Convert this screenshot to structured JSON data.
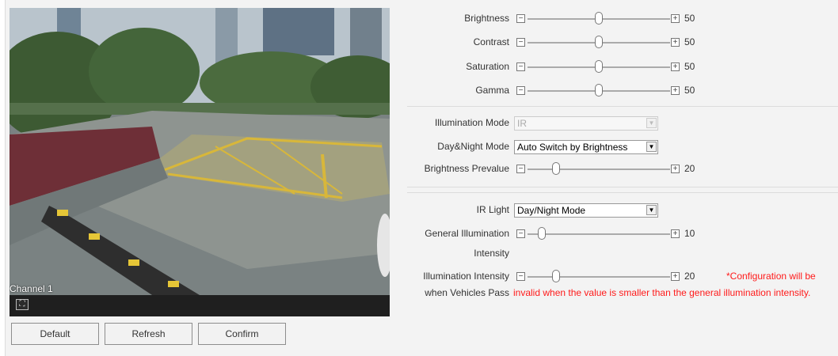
{
  "video": {
    "channel_label": "Channel 1",
    "fullscreen_icon": "fullscreen-icon"
  },
  "buttons": {
    "default": "Default",
    "refresh": "Refresh",
    "confirm": "Confirm"
  },
  "sliders": {
    "brightness": {
      "label": "Brightness",
      "value": "50",
      "level": 0.5
    },
    "contrast": {
      "label": "Contrast",
      "value": "50",
      "level": 0.5
    },
    "saturation": {
      "label": "Saturation",
      "value": "50",
      "level": 0.5
    },
    "gamma": {
      "label": "Gamma",
      "value": "50",
      "level": 0.5
    },
    "brightness_prevalue": {
      "label": "Brightness Prevalue",
      "value": "20",
      "level": 0.2
    },
    "general_illumination": {
      "label_line1": "General Illumination",
      "label_line2": "Intensity",
      "value": "10",
      "level": 0.1
    },
    "vehicle_illumination": {
      "label_line1": "Illumination Intensity",
      "label_line2": "when Vehicles Pass",
      "value": "20",
      "level": 0.2
    }
  },
  "selects": {
    "illumination_mode": {
      "label": "Illumination Mode",
      "value": "IR",
      "disabled": true
    },
    "day_night_mode": {
      "label": "Day&Night Mode",
      "value": "Auto Switch by Brightness"
    },
    "ir_light": {
      "label": "IR Light",
      "value": "Day/Night Mode"
    }
  },
  "note": {
    "line1": "*Configuration will be",
    "line2": "invalid when the value is smaller than the general illumination intensity."
  },
  "icons": {
    "minus": "−",
    "plus": "+",
    "dropdown": "▼"
  },
  "colors": {
    "note_red": "#ff1a1a",
    "panel_bg": "#f3f3f3"
  }
}
